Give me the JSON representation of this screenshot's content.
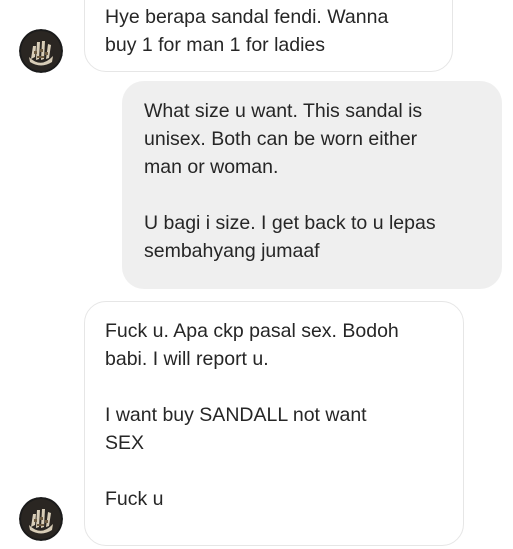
{
  "conversation": {
    "messages": [
      {
        "sender": "contact",
        "paragraphs": [
          [
            "Hye berapa sandal fendi. Wanna",
            "buy 1 for man 1 for ladies"
          ]
        ]
      },
      {
        "sender": "me",
        "paragraphs": [
          [
            "What size u want. This sandal is",
            "unisex. Both can be worn either",
            "man or woman."
          ],
          [
            "U bagi i size. I get back to u lepas",
            "sembahyang jumaaf"
          ]
        ]
      },
      {
        "sender": "contact",
        "paragraphs": [
          [
            "Fuck u. Apa ckp pasal sex. Bodoh",
            "babi. I will report u."
          ],
          [
            "I want buy SANDALL not want",
            "SEX"
          ],
          [
            "Fuck u"
          ]
        ]
      }
    ]
  },
  "colors": {
    "incoming_bubble_bg": "#ffffff",
    "incoming_bubble_border": "#e6e6e6",
    "outgoing_bubble_bg": "#efefef",
    "text": "#262626"
  },
  "icons": {
    "avatar": "contact-avatar"
  }
}
